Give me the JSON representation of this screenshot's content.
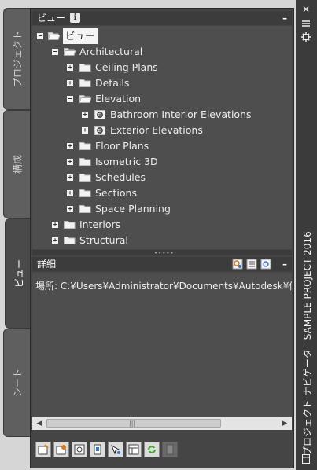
{
  "tabs": [
    {
      "label": "プロジェクト",
      "active": false
    },
    {
      "label": "構成",
      "active": false
    },
    {
      "label": "ビュー",
      "active": true
    },
    {
      "label": "シート",
      "active": false
    }
  ],
  "window": {
    "title": "プロジェクト ナビゲータ - SAMPLE PROJECT 2016",
    "close_icon": "close-icon",
    "autohide_icon": "autohide-icon",
    "properties_icon": "properties-icon"
  },
  "views_panel": {
    "title": "ビュー",
    "info_glyph": "i",
    "minimize_glyph": "–"
  },
  "tree": {
    "root": "ビュー",
    "architectural": "Architectural",
    "ceiling_plans": "Ceiling Plans",
    "details": "Details",
    "elevation": "Elevation",
    "bathroom_interior": "Bathroom Interior Elevations",
    "exterior": "Exterior Elevations",
    "floor_plans": "Floor Plans",
    "isometric": "Isometric 3D",
    "schedules": "Schedules",
    "sections": "Sections",
    "space_planning": "Space Planning",
    "interiors": "Interiors",
    "structural": "Structural"
  },
  "detail_panel": {
    "title": "詳細",
    "minimize_glyph": "–",
    "location_text": "場所: C:¥Users¥Administrator¥Documents¥Autodesk¥個"
  },
  "toolbar": {
    "buttons": [
      "new-view-icon",
      "open-view-icon",
      "regenerate-icon",
      "copy-icon",
      "repath-icon",
      "properties-icon",
      "refresh-icon",
      "drawing-management-icon"
    ]
  },
  "colors": {
    "panel_bg": "#4e4e4e",
    "header_bg": "#3c3c3c",
    "selection_bg": "#f4f4f4",
    "refresh_green": "#3fae2a"
  }
}
